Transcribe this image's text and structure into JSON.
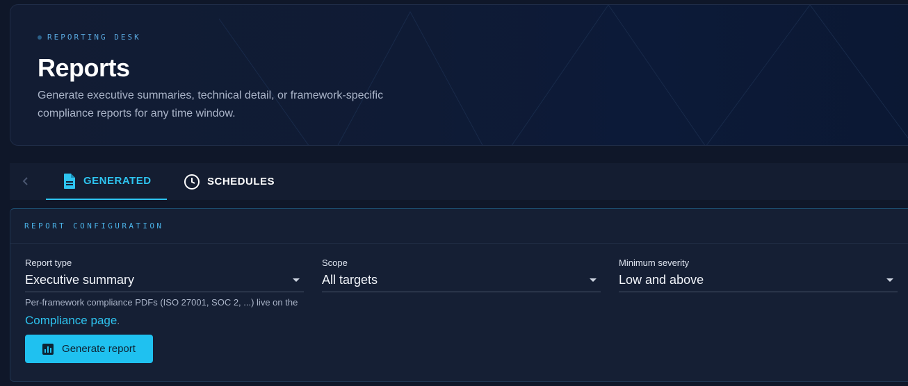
{
  "hero": {
    "eyebrow": "REPORTING DESK",
    "title": "Reports",
    "subtitle": "Generate executive summaries, technical detail, or framework-specific compliance reports for any time window."
  },
  "tabs": [
    {
      "label": "GENERATED",
      "icon": "document-icon",
      "active": true
    },
    {
      "label": "SCHEDULES",
      "icon": "clock-icon",
      "active": false
    }
  ],
  "config": {
    "header": "REPORT CONFIGURATION",
    "fields": [
      {
        "label": "Report type",
        "value": "Executive summary"
      },
      {
        "label": "Scope",
        "value": "All targets"
      },
      {
        "label": "Minimum severity",
        "value": "Low and above"
      }
    ],
    "hint_prefix": "Per-framework compliance PDFs (ISO 27001, SOC 2, ...) live on the ",
    "hint_link": "Compliance page",
    "hint_suffix": ".",
    "generate_label": "Generate report"
  },
  "colors": {
    "accent": "#2ec4f0",
    "background": "#0f1729",
    "button": "#1fc1f0"
  }
}
